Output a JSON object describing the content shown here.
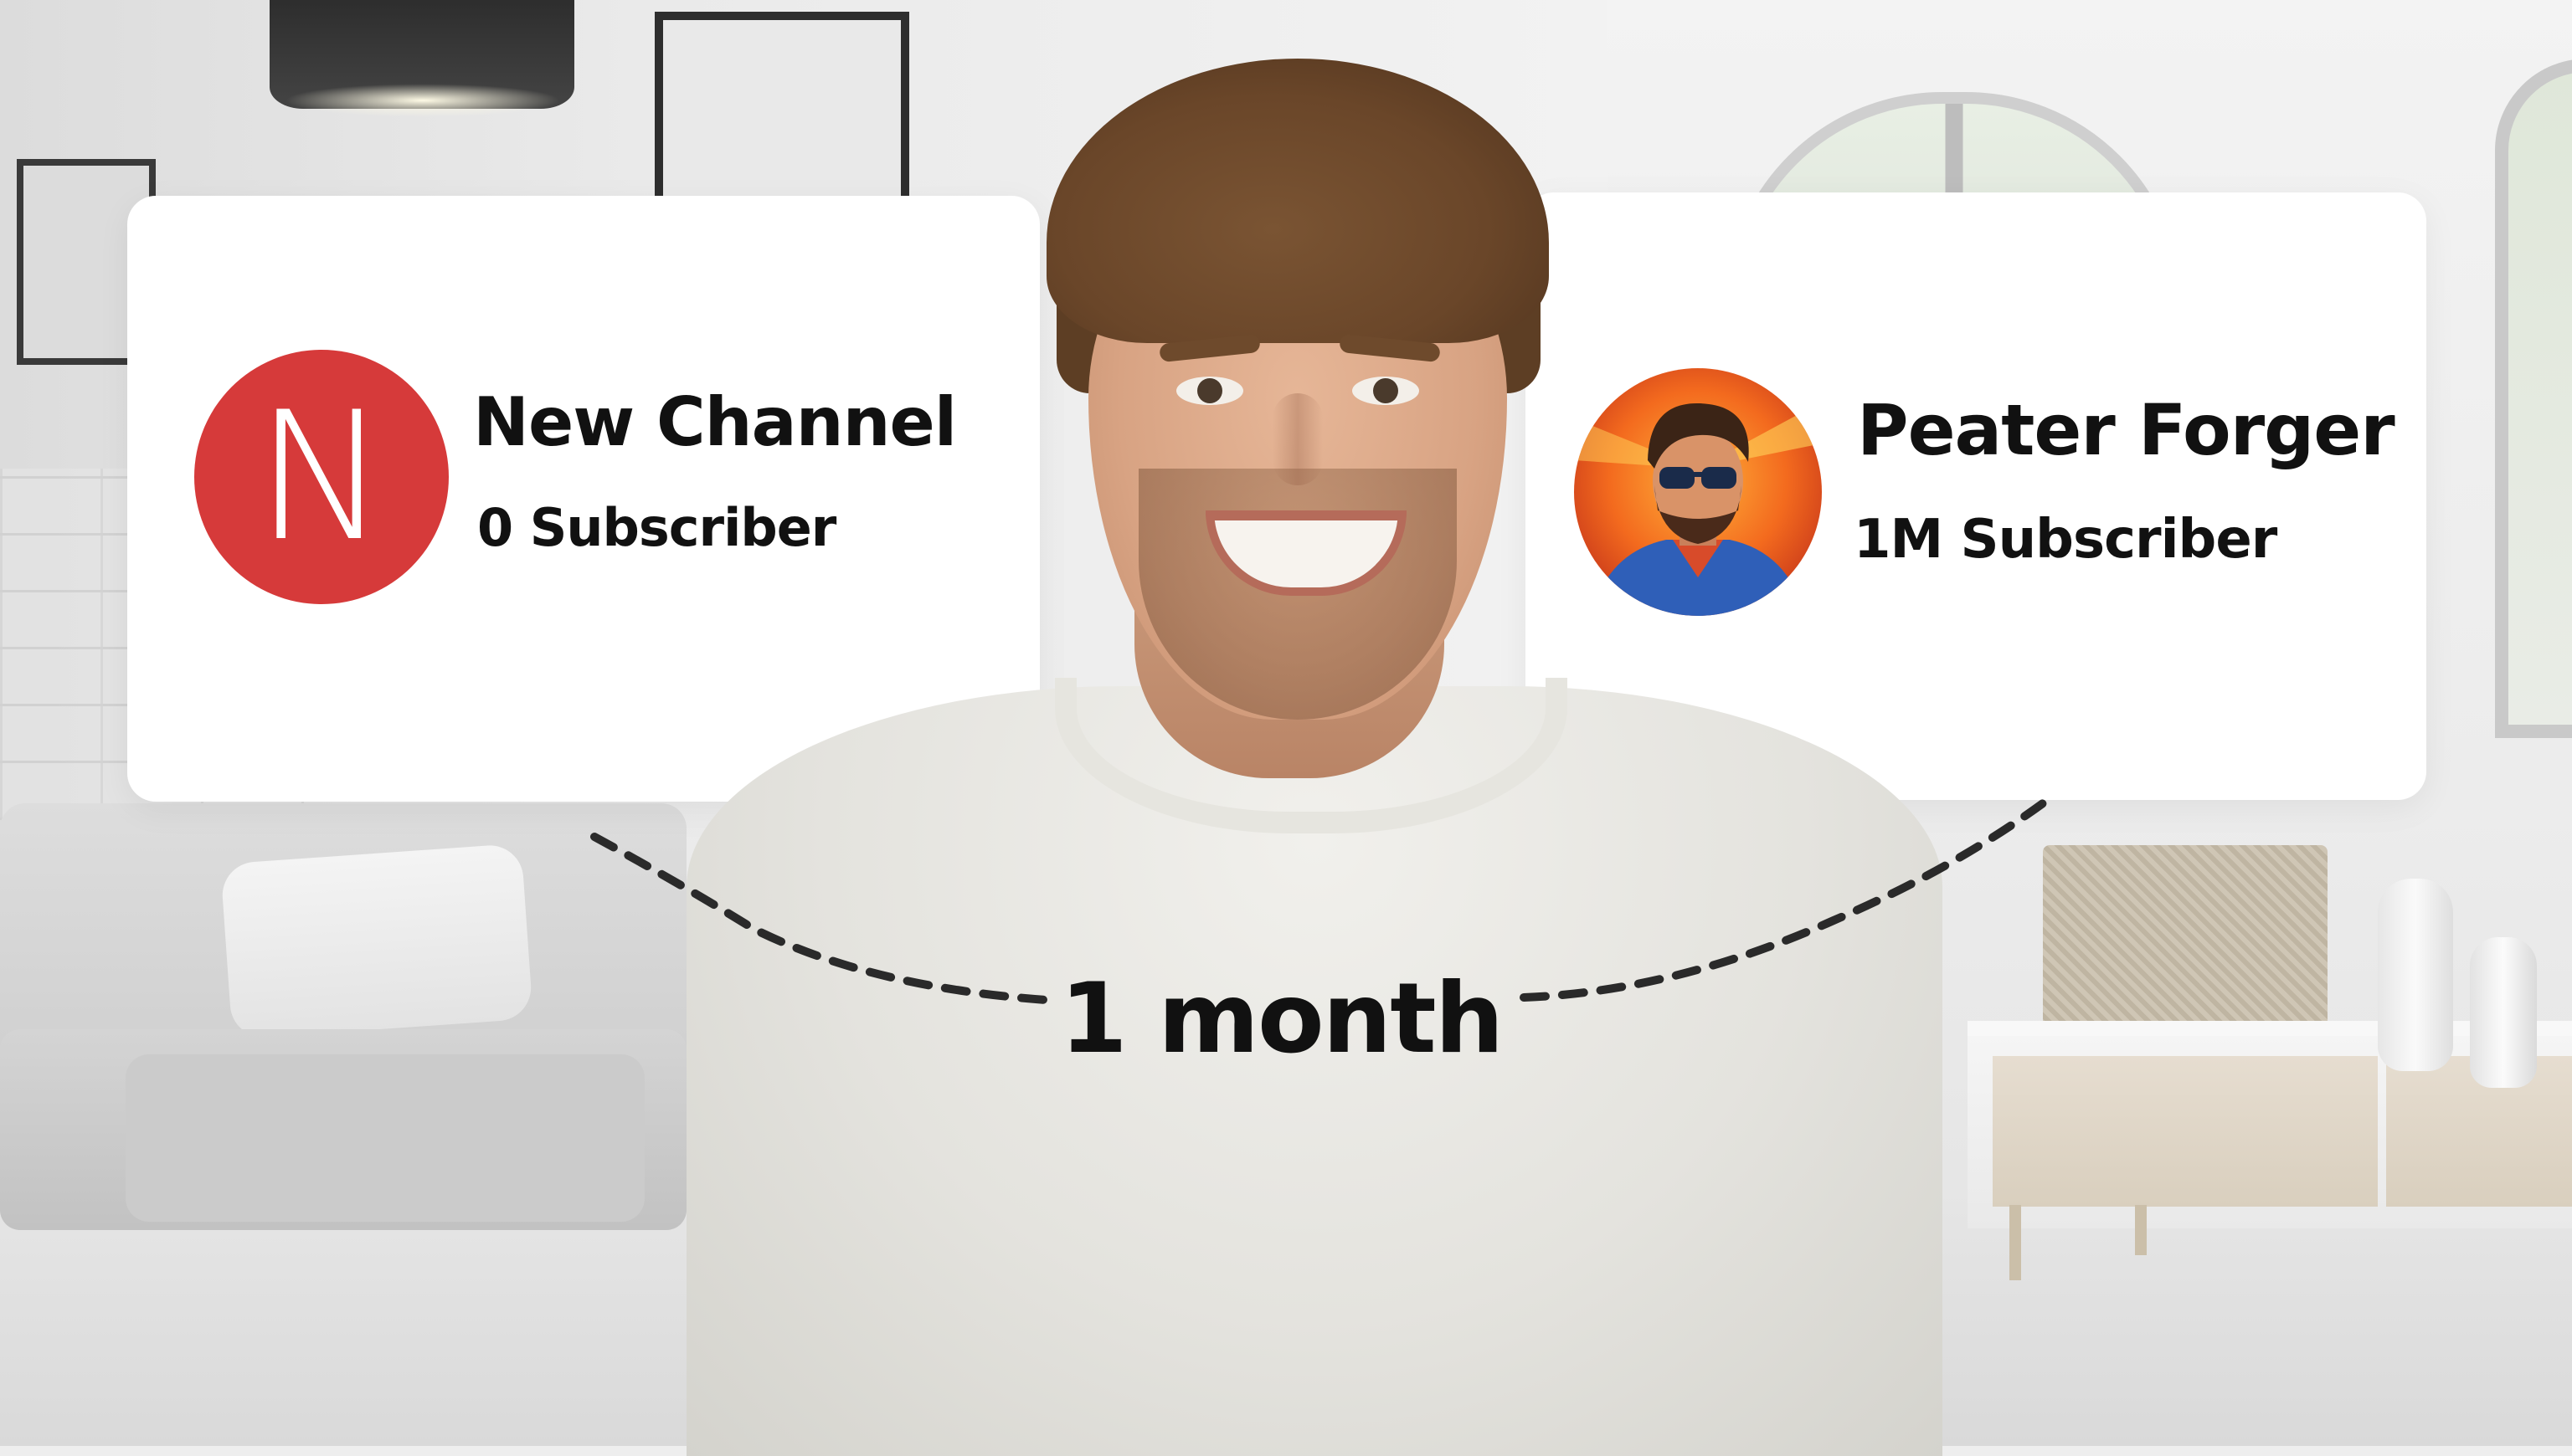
{
  "left_card": {
    "avatar_letter": "N",
    "avatar_color": "#d63a3a",
    "channel_name": "New Channel",
    "subscribers": "0 Subscriber"
  },
  "right_card": {
    "avatar_icon": "man-with-sunglasses-avatar-icon",
    "channel_name": "Peater Forger",
    "subscribers": "1M Subscriber"
  },
  "timeline": {
    "label": "1 month"
  },
  "background_subject": "smiling-young-man-photo"
}
